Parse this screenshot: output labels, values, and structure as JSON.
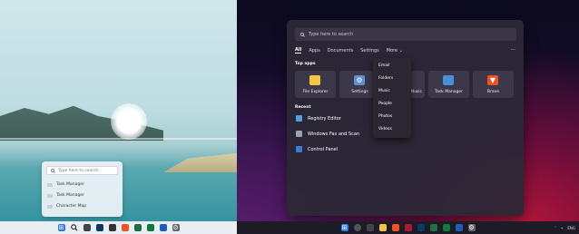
{
  "light": {
    "search": {
      "placeholder": "Type here to search",
      "results": [
        "Task Manager",
        "Task Manager",
        "Character Map"
      ]
    }
  },
  "dark": {
    "search": {
      "placeholder": "Type here to search"
    },
    "filters": [
      "All",
      "Apps",
      "Documents",
      "Settings",
      "More"
    ],
    "more_menu_dots": "···",
    "top_apps_title": "Top apps",
    "top_apps": [
      {
        "label": "File Explorer",
        "icon": "folder-icon",
        "color": "#f4c542"
      },
      {
        "label": "Settings",
        "icon": "gear-icon",
        "color": "#5b8fd6"
      },
      {
        "label": "Music",
        "icon": "music-icon",
        "color": "#c04dd6"
      },
      {
        "label": "Task Manager",
        "icon": "task-manager-icon",
        "color": "#4a90d9"
      },
      {
        "label": "Brave",
        "icon": "brave-icon",
        "color": "#f25022"
      }
    ],
    "recent_title": "Recent",
    "recent": [
      {
        "label": "Registry Editor",
        "icon": "registry-icon",
        "color": "#4aa3df"
      },
      {
        "label": "Windows Fax and Scan",
        "icon": "fax-icon",
        "color": "#9aa4b0"
      },
      {
        "label": "Control Panel",
        "icon": "control-panel-icon",
        "color": "#3a7bd5"
      }
    ],
    "dropdown": [
      "Email",
      "Folders",
      "Music",
      "People",
      "Photos",
      "Videos"
    ],
    "tray": {
      "lang": "ENG"
    }
  },
  "colors": {
    "accent": "#3a7bd5",
    "dark_panel": "#2c2836",
    "light_taskbar": "#e9eef3"
  }
}
